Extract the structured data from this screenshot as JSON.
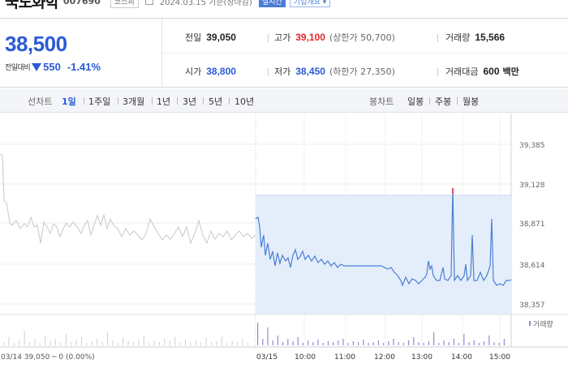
{
  "header": {
    "name": "국도화학",
    "code": "007690",
    "market": "코스피",
    "date": "2024.03.15 기준(장마감)",
    "realtime": "실시간",
    "company_info": "기업개요 ▾"
  },
  "price": {
    "current": "38,500",
    "change_label": "전일대비",
    "change_value": "550",
    "change_pct": "-1.41%"
  },
  "stats": {
    "prev_close_label": "전일",
    "prev_close": "39,050",
    "high_label": "고가",
    "high": "39,100",
    "upper_limit": "(상한가 50,700)",
    "volume_label": "거래량",
    "volume": "15,566",
    "open_label": "시가",
    "open": "38,800",
    "low_label": "저가",
    "low": "38,450",
    "lower_limit": "(하한가 27,350)",
    "amount_label": "거래대금",
    "amount": "600",
    "amount_unit": "백만"
  },
  "toolbar": {
    "line_chart_label": "선차트",
    "periods": [
      "1일",
      "1주일",
      "3개월",
      "1년",
      "3년",
      "5년",
      "10년"
    ],
    "active_period": "1일",
    "candle_label": "봉차트",
    "candle_periods": [
      "일봉",
      "주봉",
      "월봉"
    ]
  },
  "chart": {
    "y_ticks": [
      "39,385",
      "39,128",
      "38,871",
      "38,614",
      "38,357"
    ],
    "x_ticks": [
      "03/15",
      "10:00",
      "11:00",
      "12:00",
      "13:00",
      "14:00",
      "15:00"
    ],
    "prev_day_info": "03/14  39,050 ─ 0 (0.00%)",
    "volume_legend": "거래량",
    "colors": {
      "line": "#4a7fd6",
      "fill": "#e4edfa",
      "prev_line": "#c8c8c8",
      "high_mark": "#e3242b",
      "volume": "#9b86d6"
    }
  }
}
